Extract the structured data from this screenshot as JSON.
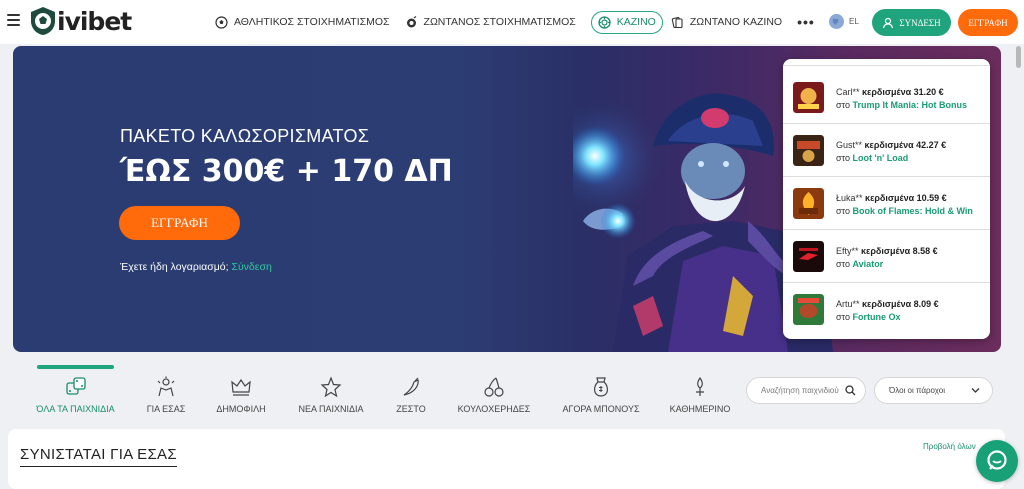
{
  "brand": {
    "logo_text": "ivibet"
  },
  "nav": {
    "items": [
      {
        "label": "ΑΘΛΗΤΙΚΟΣ ΣΤΟΙΧΗΜΑΤΙΣΜΟΣ",
        "icon": "soccer-ball-icon"
      },
      {
        "label": "ΖΩΝΤΑΝΟΣ ΣΤΟΙΧΗΜΑΤΙΣΜΟΣ",
        "icon": "live-ball-icon"
      },
      {
        "label": "ΚΑΖΙΝΟ",
        "icon": "casino-chip-icon",
        "active": true
      },
      {
        "label": "ΖΩΝΤΑΝΟ ΚΑΖΙΝΟ",
        "icon": "cards-icon"
      }
    ],
    "more": "•••"
  },
  "header": {
    "language": "EL",
    "login_label": "ΣΥΝΔΕΣΗ",
    "register_label": "ΕΓΓΡΑΦΗ"
  },
  "hero": {
    "title": "ΠΑΚΕΤΟ ΚΑΛΩΣΟΡΙΣΜΑΤΟΣ",
    "amount": "ΈΩΣ 300€ + 170 ΔΠ",
    "cta_label": "ΕΓΓΡΑΦΗ",
    "account_text": "Έχετε ήδη λογαριασμό;",
    "account_link": "Σύνδεση"
  },
  "recent_wins": [
    {
      "player": "Carl**",
      "won_label": "κερδισμένα",
      "amount": "31.20 €",
      "at": "στο",
      "game": "Trump It Mania: Hot Bonus"
    },
    {
      "player": "Gust**",
      "won_label": "κερδισμένα",
      "amount": "42.27 €",
      "at": "στο",
      "game": "Loot 'n' Load"
    },
    {
      "player": "Łuka**",
      "won_label": "κερδισμένα",
      "amount": "10.59 €",
      "at": "στο",
      "game": "Book of Flames: Hold & Win"
    },
    {
      "player": "Efty**",
      "won_label": "κερδισμένα",
      "amount": "8.58 €",
      "at": "στο",
      "game": "Aviator"
    },
    {
      "player": "Artu**",
      "won_label": "κερδισμένα",
      "amount": "8.09 €",
      "at": "στο",
      "game": "Fortune Ox"
    }
  ],
  "categories": [
    {
      "label": "ΌΛΑ ΤΑ ΠΑΙΧΝΙΔΙΑ",
      "icon": "dice-icon",
      "active": true
    },
    {
      "label": "ΓΙΑ ΕΣΑΣ",
      "icon": "thumbs-up-icon"
    },
    {
      "label": "ΔΗΜΟΦΙΛΗ",
      "icon": "crown-icon"
    },
    {
      "label": "ΝΕΑ ΠΑΙΧΝΙΔΙΑ",
      "icon": "star-icon"
    },
    {
      "label": "ΖΕΣΤΟ",
      "icon": "chili-pepper-icon"
    },
    {
      "label": "ΚΟΥΛΟΧΕΡΗΔΕΣ",
      "icon": "cherries-icon"
    },
    {
      "label": "ΑΓΟΡΑ ΜΠΟΝΟΥΣ",
      "icon": "money-bag-icon"
    },
    {
      "label": "ΚΑΘΗΜΕΡΙΝΟ",
      "icon": "daily-icon"
    }
  ],
  "filters": {
    "search_placeholder": "Αναζήτηση παιχνιδιού",
    "provider_value": "Όλοι οι πάροχοι"
  },
  "recommended": {
    "title": "ΣΥΝΙΣΤΑΤΑΙ ΓΙΑ ΕΣΑΣ",
    "view_all": "Προβολή όλων"
  }
}
